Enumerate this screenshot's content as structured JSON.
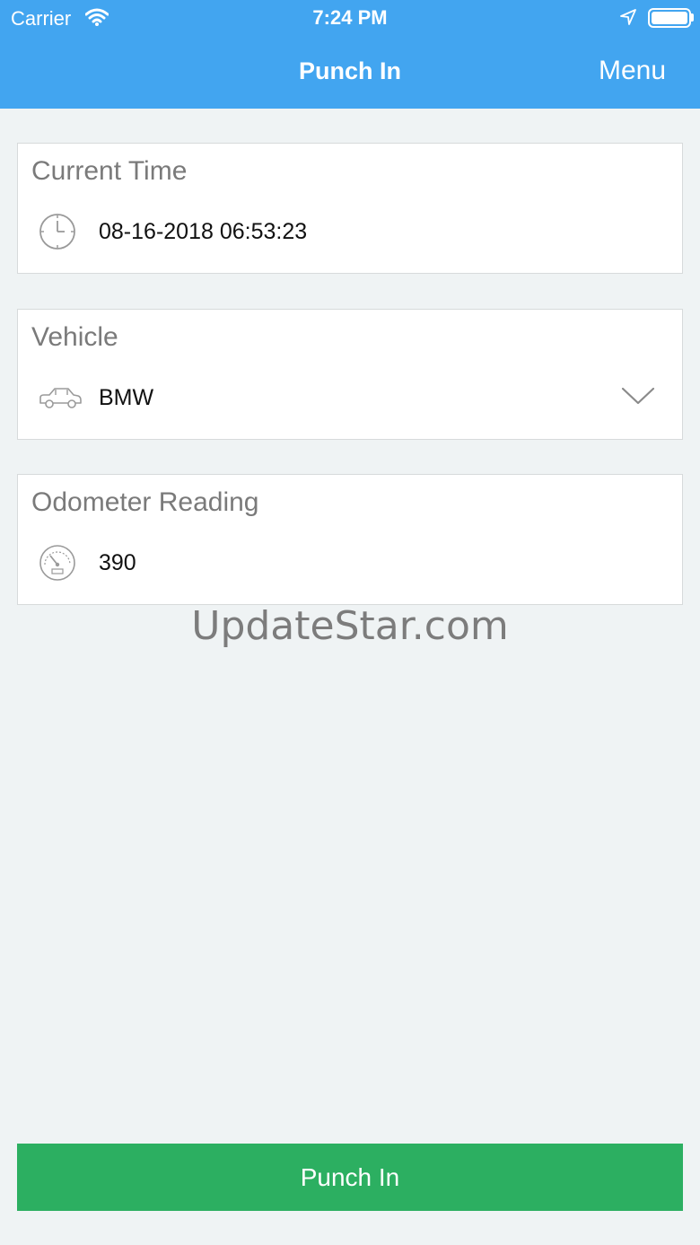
{
  "status_bar": {
    "carrier": "Carrier",
    "time": "7:24 PM",
    "wifi_icon": "wifi-icon",
    "location_icon": "location-arrow-icon",
    "battery_icon": "battery-icon"
  },
  "nav": {
    "title": "Punch In",
    "menu_label": "Menu",
    "bg_color": "#42a5f0"
  },
  "fields": {
    "current_time": {
      "label": "Current Time",
      "value": "08-16-2018 06:53:23",
      "icon": "clock-icon"
    },
    "vehicle": {
      "label": "Vehicle",
      "value": "BMW",
      "icon": "car-icon",
      "dropdown_icon": "chevron-down-icon"
    },
    "odometer": {
      "label": "Odometer Reading",
      "value": "390",
      "icon": "speedometer-icon"
    }
  },
  "watermark": "UpdateStar.com",
  "action": {
    "punch_in_label": "Punch In",
    "color": "#2caf61"
  }
}
